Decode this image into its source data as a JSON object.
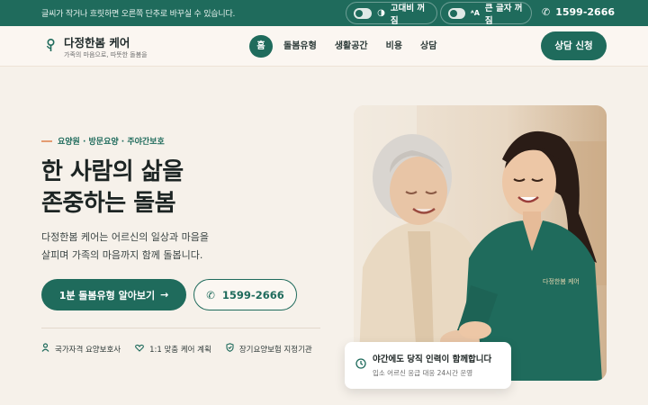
{
  "topbar": {
    "notice": "글씨가 작거나 흐릿하면 오른쪽 단추로 바꾸실 수 있습니다.",
    "contrast_label": "고대비 꺼짐",
    "bigtext_label": "큰 글자 꺼짐",
    "phone": "1599-2666"
  },
  "header": {
    "logo_title": "다정한봄 케어",
    "logo_sub": "가족의 마음으로, 따뜻한 돌봄을",
    "nav": [
      "홈",
      "돌봄유형",
      "생활공간",
      "비용",
      "상담"
    ],
    "cta": "상담 신청"
  },
  "hero": {
    "eyebrow": "요양원 · 방문요양 · 주야간보호",
    "headline_line1": "한 사람의 삶을",
    "headline_line2": "존중하는 돌봄",
    "desc_line1": "다정한봄 케어는 어르신의 일상과 마음을",
    "desc_line2": "살피며 가족의 마음까지 함께 돌봅니다.",
    "primary_button": "1분 돌봄유형 알아보기",
    "secondary_button": "1599-2666",
    "features": [
      "국가자격 요양보호사",
      "1:1 맞춤 케어 계획",
      "장기요양보험 지정기관"
    ]
  },
  "photo": {
    "uniform_text": "다정한봄 케어"
  },
  "badge": {
    "title": "야간에도 당직 인력이 함께합니다",
    "sub": "입소 어르신 응급 대응 24시간 운영"
  },
  "colors": {
    "brand": "#1f6b5c",
    "accent": "#e49c72",
    "background": "#f6f1ea"
  }
}
